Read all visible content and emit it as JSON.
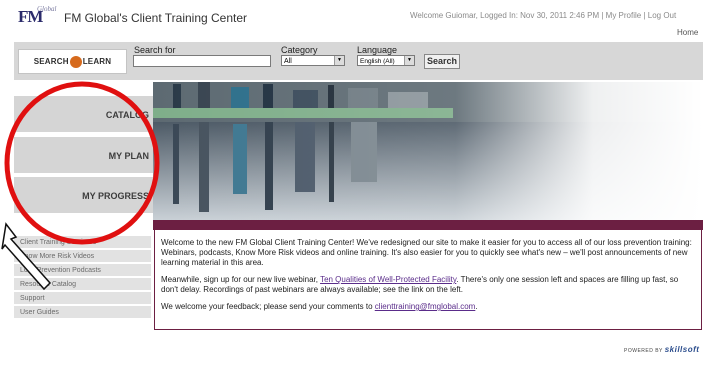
{
  "header": {
    "logo_text": "FM",
    "logo_sub": "Global",
    "site_title": "FM Global's Client Training Center",
    "welcome_text": "Welcome Guiomar, Logged In: Nov 30, 2011 2:46 PM | My Profile | Log Out",
    "home_link": "Home"
  },
  "search": {
    "logo_left": "SEARCH",
    "logo_right": "LEARN",
    "search_label": "Search for",
    "search_value": "",
    "category_label": "Category",
    "category_value": "All",
    "language_label": "Language",
    "language_value": "English (All)",
    "button_label": "Search"
  },
  "menu": {
    "catalog": "CATALOG",
    "my_plan": "MY PLAN",
    "my_progress": "MY PROGRESS"
  },
  "submenu": [
    "Client Training Seminars",
    "Know More Risk Videos",
    "Loss Prevention Podcasts",
    "Resource Catalog",
    "Support",
    "User Guides"
  ],
  "welcome_box": {
    "p1": "Welcome to the new FM Global Client Training Center! We've redesigned our site to make it easier for you to access all of our loss prevention training: Webinars, podcasts, Know More Risk videos and online training. It's also easier for you to quickly see what's new – we'll post announcements of new learning material in this area.",
    "p2_before": "Meanwhile, sign up for our new live webinar, ",
    "p2_link": "Ten Qualities of Well-Protected Facility",
    "p2_after": ". There's only one session left and spaces are filling up fast, so don't delay. Recordings of past webinars are always available; see the link on the left.",
    "p3_before": "We welcome your feedback; please send your comments to ",
    "p3_link": "clienttraining@fmglobal.com",
    "p3_after": "."
  },
  "footer": {
    "powered_by": "POWERED BY",
    "brand": "skillsoft"
  },
  "annotation": {
    "circle_color": "#e01010",
    "arrow_color": "#111111"
  }
}
